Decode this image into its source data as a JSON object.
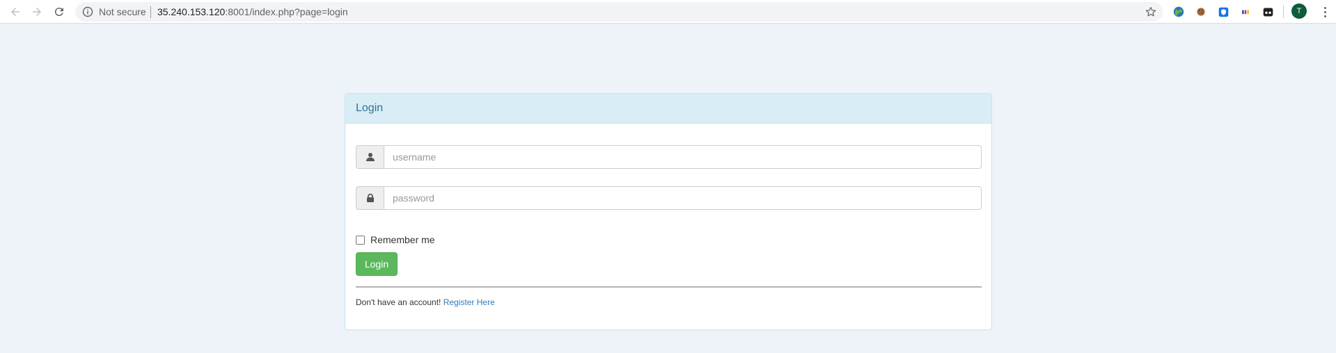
{
  "browser": {
    "security_label": "Not secure",
    "url_host": "35.240.153.120",
    "url_rest": ":8001/index.php?page=login",
    "profile_initial": "T"
  },
  "panel": {
    "title": "Login"
  },
  "form": {
    "username_placeholder": "username",
    "password_placeholder": "password",
    "remember_label": "Remember me",
    "login_button": "Login"
  },
  "footer": {
    "prompt": "Don't have an account!",
    "register_link": "Register Here"
  },
  "colors": {
    "page_bg": "#eef2f9",
    "panel_heading_bg": "#d9edf7",
    "panel_title": "#31708f",
    "button_success": "#5cb85c",
    "link": "#337ab7"
  }
}
